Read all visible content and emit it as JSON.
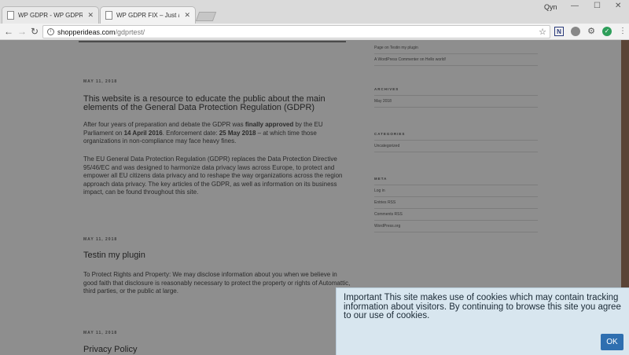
{
  "browser": {
    "tabs": [
      {
        "title": "WP GDPR - WP GDPR FIX",
        "active": false
      },
      {
        "title": "WP GDPR FIX – Just anoth",
        "active": true
      }
    ],
    "profile_label": "Qyn",
    "url_host": "shopperideas.com",
    "url_path": "/gdprtest/"
  },
  "posts": [
    {
      "date": "MAY 11, 2018",
      "title": "This website is a resource to educate the public about the main elements of the General Data Protection Regulation (GDPR)",
      "p1_a": "After four years of preparation and debate the GDPR was ",
      "p1_b": "finally approved",
      "p1_c": " by the EU Parliament on ",
      "p1_d": "14 April 2016",
      "p1_e": ". Enforcement date: ",
      "p1_f": "25 May 2018",
      "p1_g": " – at which time those organizations in non-compliance may face heavy fines.",
      "p2": "The EU General Data Protection Regulation (GDPR) replaces the Data Protection Directive 95/46/EC and was designed to harmonize data privacy laws across Europe, to protect and empower all EU citizens data privacy and to reshape the way organizations across the region approach data privacy. The key articles of the GDPR, as well as information on its business impact, can be found throughout this site."
    },
    {
      "date": "MAY 11, 2018",
      "title": "Testin my plugin",
      "p1": "To Protect Rights and Property: We may disclose information about you when we believe in good faith that disclosure is reasonably necessary to protect the property or rights of Automattic, third parties, or the public at large."
    },
    {
      "date": "MAY 11, 2018",
      "title": "Privacy Policy"
    }
  ],
  "sidebar": {
    "recent_comments": [
      "Page on Testin my plugin",
      "A WordPress Commenter on Hello world!"
    ],
    "archives": {
      "heading": "ARCHIVES",
      "items": [
        "May 2018"
      ]
    },
    "categories": {
      "heading": "CATEGORIES",
      "items": [
        "Uncategorized"
      ]
    },
    "meta": {
      "heading": "META",
      "items": [
        "Log in",
        "Entries RSS",
        "Comments RSS",
        "WordPress.org"
      ]
    }
  },
  "cookie_banner": {
    "text": "Important This site makes use of cookies which may contain tracking information about visitors. By continuing to browse this site you agree to our use of cookies.",
    "ok_label": "OK",
    "background": "#d8e6ef",
    "button_color": "#2f6fb0"
  }
}
